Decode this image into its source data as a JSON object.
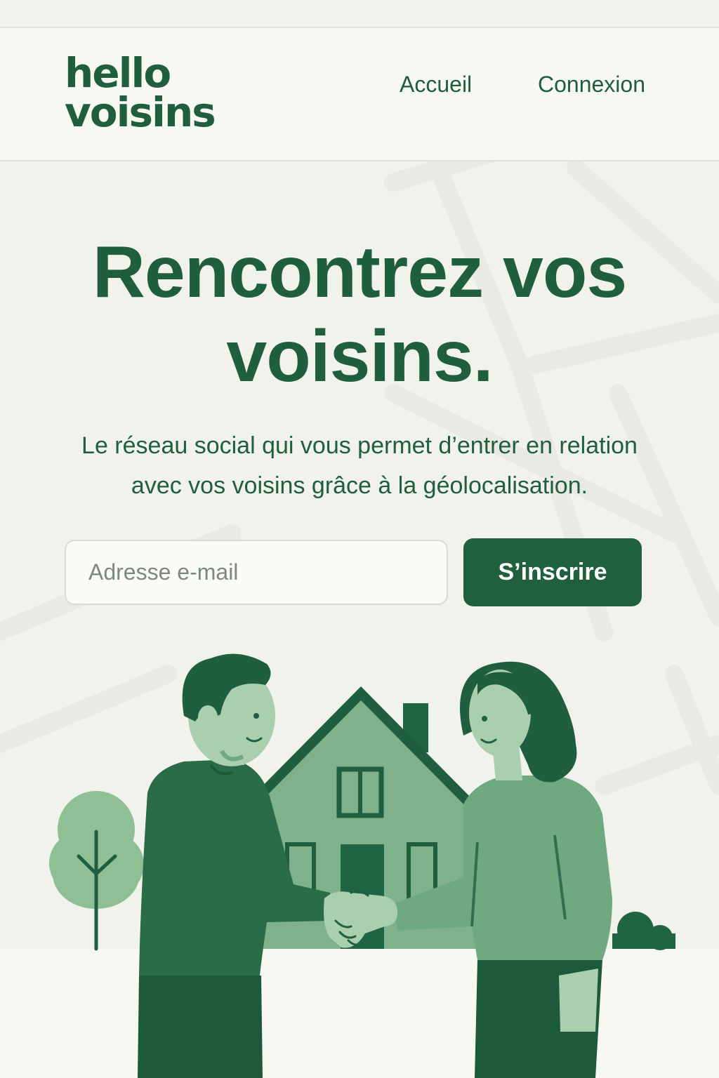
{
  "brand": {
    "line1": "hello",
    "line2": "voisins"
  },
  "nav": {
    "home": "Accueil",
    "login": "Connexion"
  },
  "hero": {
    "title_line1": "Rencontrez vos",
    "title_line2": "voisins.",
    "subtitle_line1": "Le réseau social qui vous permet d’entrer en relation",
    "subtitle_line2": "avec vos voisins grâce à la géolocalisation."
  },
  "signup": {
    "email_placeholder": "Adresse e-mail",
    "button_label": "S’inscrire"
  },
  "colors": {
    "brand_green": "#1f5e3f",
    "light_green": "#6fa97f",
    "pale_green": "#a9cfae",
    "background": "#f2f2ec"
  },
  "illustration": {
    "icons": [
      "tree-icon",
      "house-icon",
      "man-figure",
      "woman-figure",
      "handshake-icon",
      "bush-icon"
    ]
  }
}
